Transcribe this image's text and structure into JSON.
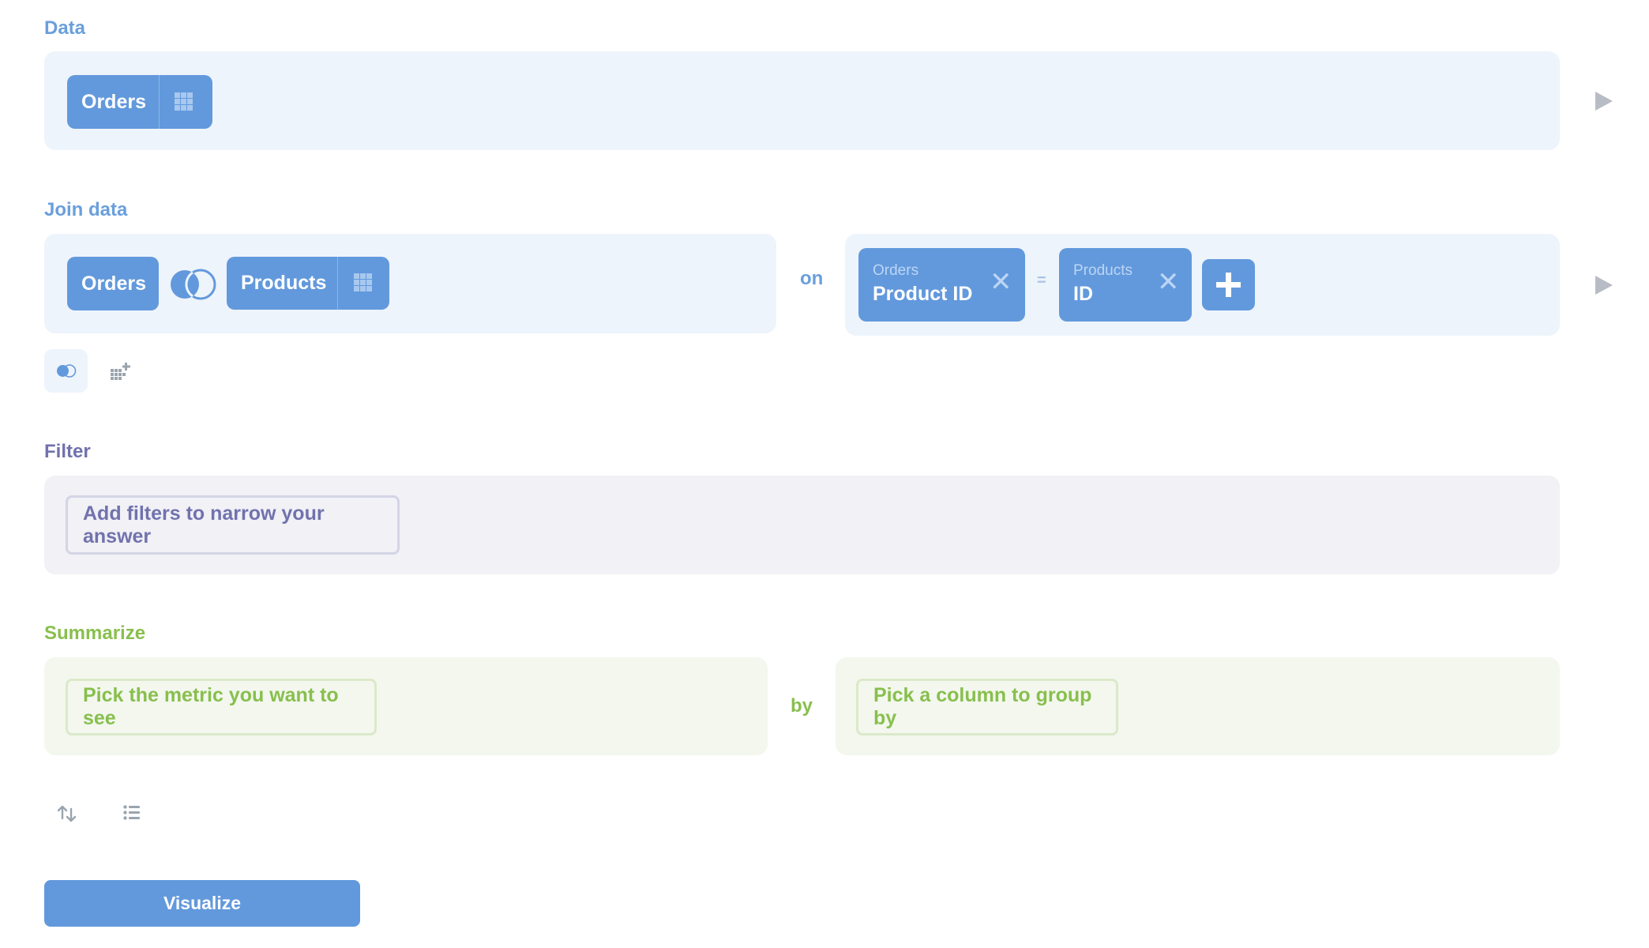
{
  "data_section": {
    "label": "Data",
    "source_table": "Orders",
    "table_icon": "grid-icon",
    "run_icon": "play-icon"
  },
  "join_section": {
    "label": "Join data",
    "left_table": "Orders",
    "join_type_icon": "left-join-venn-icon",
    "right_table": "Products",
    "on_label": "on",
    "conditions": [
      {
        "left_table": "Orders",
        "left_column": "Product ID",
        "operator": "=",
        "right_table": "Products",
        "right_column": "ID"
      }
    ],
    "add_condition_icon": "plus-icon",
    "remove_icon": "close-icon",
    "run_icon": "play-icon",
    "toolbar": [
      {
        "icon": "join-venn-icon",
        "active": true
      },
      {
        "icon": "add-table-grid-icon",
        "active": false
      }
    ]
  },
  "filter_section": {
    "label": "Filter",
    "placeholder": "Add filters to narrow your answer"
  },
  "summarize_section": {
    "label": "Summarize",
    "metric_placeholder": "Pick the metric you want to see",
    "by_label": "by",
    "group_placeholder": "Pick a column to group by"
  },
  "bottom_toolbar": [
    {
      "icon": "sort-icon"
    },
    {
      "icon": "limit-list-icon"
    }
  ],
  "visualize_button": "Visualize",
  "colors": {
    "brand_blue": "#6299dc",
    "filter_purple": "#7172ad",
    "summarize_green": "#88bf4d",
    "run_arrow_gray": "#b8bcc4"
  }
}
